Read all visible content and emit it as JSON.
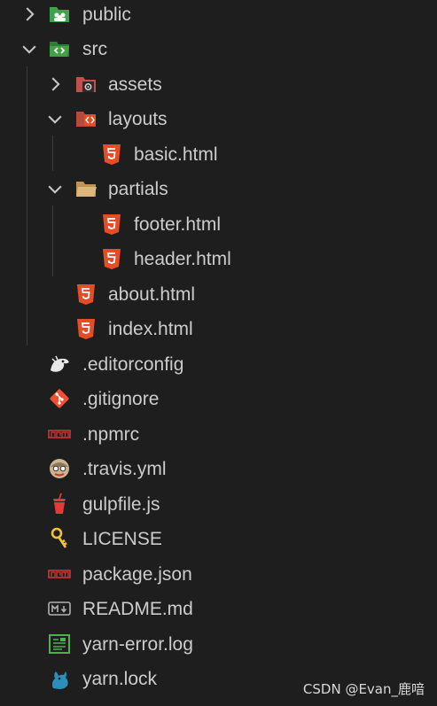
{
  "explorer": {
    "items": [
      {
        "label": "public",
        "type": "folder",
        "icon": "public-folder-icon",
        "expanded": false
      },
      {
        "label": "src",
        "type": "folder",
        "icon": "src-folder-icon",
        "expanded": true
      },
      {
        "label": "assets",
        "type": "folder",
        "icon": "assets-folder-icon",
        "expanded": false
      },
      {
        "label": "layouts",
        "type": "folder",
        "icon": "layouts-folder-icon",
        "expanded": true
      },
      {
        "label": "basic.html",
        "type": "file",
        "icon": "html5-icon"
      },
      {
        "label": "partials",
        "type": "folder",
        "icon": "folder-open-icon",
        "expanded": true
      },
      {
        "label": "footer.html",
        "type": "file",
        "icon": "html5-icon"
      },
      {
        "label": "header.html",
        "type": "file",
        "icon": "html5-icon"
      },
      {
        "label": "about.html",
        "type": "file",
        "icon": "html5-icon"
      },
      {
        "label": "index.html",
        "type": "file",
        "icon": "html5-icon"
      },
      {
        "label": ".editorconfig",
        "type": "file",
        "icon": "editorconfig-icon"
      },
      {
        "label": ".gitignore",
        "type": "file",
        "icon": "git-icon"
      },
      {
        "label": ".npmrc",
        "type": "file",
        "icon": "npm-icon"
      },
      {
        "label": ".travis.yml",
        "type": "file",
        "icon": "travis-icon"
      },
      {
        "label": "gulpfile.js",
        "type": "file",
        "icon": "gulp-icon"
      },
      {
        "label": "LICENSE",
        "type": "file",
        "icon": "license-key-icon"
      },
      {
        "label": "package.json",
        "type": "file",
        "icon": "npm-icon"
      },
      {
        "label": "README.md",
        "type": "file",
        "icon": "markdown-icon"
      },
      {
        "label": "yarn-error.log",
        "type": "file",
        "icon": "log-icon"
      },
      {
        "label": "yarn.lock",
        "type": "file",
        "icon": "yarn-icon"
      }
    ]
  },
  "watermark": "CSDN @Evan_鹿喑",
  "colors": {
    "background": "#1e1e1e",
    "text": "#cccccc",
    "html5": "#e44d26",
    "folder_green": "#4caf50",
    "npm_red": "#cb3837",
    "git_red": "#f05133"
  }
}
